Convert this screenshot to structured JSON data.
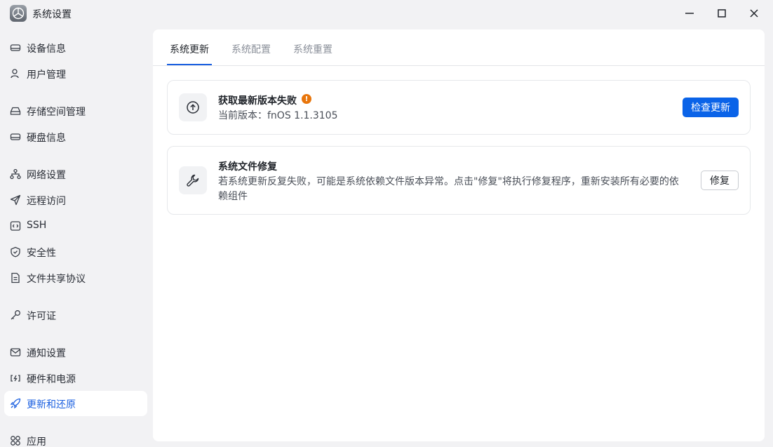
{
  "window": {
    "title": "系统设置",
    "icon": "app-logo-icon"
  },
  "sidebar": {
    "items": [
      {
        "label": "设备信息",
        "icon": "device-icon"
      },
      {
        "label": "用户管理",
        "icon": "user-icon"
      },
      {
        "label": "存储空间管理",
        "icon": "storage-icon"
      },
      {
        "label": "硬盘信息",
        "icon": "disk-icon"
      },
      {
        "label": "网络设置",
        "icon": "network-icon"
      },
      {
        "label": "远程访问",
        "icon": "send-icon"
      },
      {
        "label": "SSH",
        "icon": "code-icon"
      },
      {
        "label": "安全性",
        "icon": "shield-icon"
      },
      {
        "label": "文件共享协议",
        "icon": "document-icon"
      },
      {
        "label": "许可证",
        "icon": "key-icon"
      },
      {
        "label": "通知设置",
        "icon": "mail-icon"
      },
      {
        "label": "硬件和电源",
        "icon": "power-icon"
      },
      {
        "label": "更新和还原",
        "icon": "rocket-icon",
        "active": true
      },
      {
        "label": "应用",
        "icon": "apps-icon"
      }
    ]
  },
  "tabs": [
    {
      "label": "系统更新",
      "active": true
    },
    {
      "label": "系统配置"
    },
    {
      "label": "系统重置"
    }
  ],
  "update_card": {
    "title": "获取最新版本失败",
    "warning_badge": "!",
    "current_version": "当前版本：fnOS 1.1.3105",
    "button": "检查更新"
  },
  "repair_card": {
    "title": "系统文件修复",
    "description": "若系统更新反复失败，可能是系统依赖文件版本异常。点击\"修复\"将执行修复程序，重新安装所有必要的依赖组件",
    "button": "修复"
  },
  "colors": {
    "accent": "#0a63e8",
    "warning": "#e8760c",
    "background": "#f2f2f4"
  }
}
